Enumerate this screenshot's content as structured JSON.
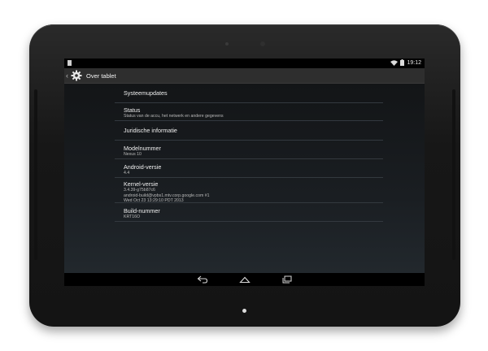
{
  "status_bar": {
    "time": "19:12",
    "icons": [
      "wifi-icon",
      "battery-icon"
    ]
  },
  "action_bar": {
    "title": "Over tablet",
    "icon": "settings-gear-icon",
    "back": "back-caret-icon"
  },
  "items": [
    {
      "title": "Systeemupdates",
      "lines": []
    },
    {
      "title": "Status",
      "lines": [
        "Status van de accu, het netwerk en andere gegevens"
      ]
    },
    {
      "title": "Juridische informatie",
      "lines": []
    },
    {
      "title": "Modelnummer",
      "lines": [
        "Nexus 10"
      ]
    },
    {
      "title": "Android-versie",
      "lines": [
        "4.4"
      ]
    },
    {
      "title": "Kernel-versie",
      "lines": [
        "3.4.39-g75b87c6",
        "android-build@vpbs1.mtv.corp.google.com #1",
        "Wed Oct 23 13:29:10 PDT 2013"
      ]
    },
    {
      "title": "Build-nummer",
      "lines": [
        "KRT16O"
      ]
    }
  ],
  "nav_bar": {
    "icons": [
      "back-icon",
      "home-icon",
      "recents-icon"
    ]
  },
  "colors": {
    "actionbar": "#2e2e2e",
    "background_top": "#131517",
    "background_bottom": "#22282d",
    "divider": "#33393f"
  }
}
